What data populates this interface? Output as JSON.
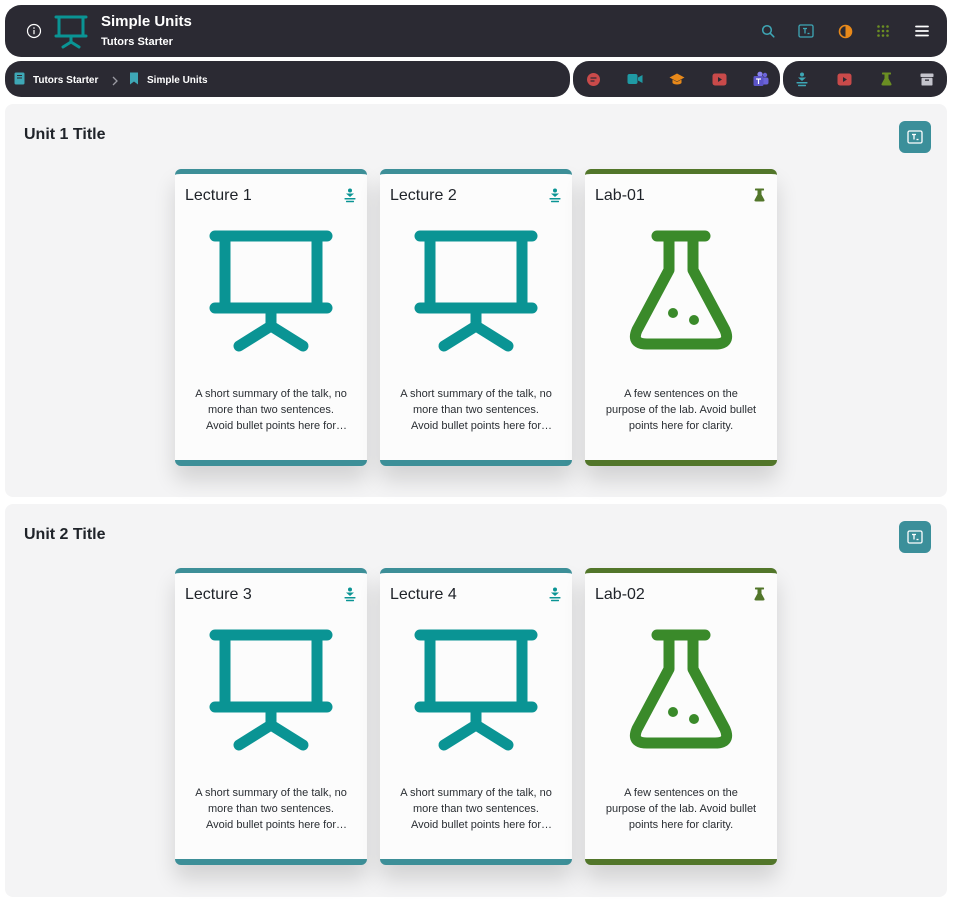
{
  "header": {
    "title": "Simple Units",
    "subtitle": "Tutors Starter",
    "icons": [
      "info-icon",
      "presentation-icon",
      "search-icon",
      "tutors-icon",
      "theme-contrast-icon",
      "apps-grid-icon",
      "hamburger-menu-icon"
    ]
  },
  "breadcrumb": {
    "items": [
      {
        "label": "Tutors Starter",
        "icon": "book-icon"
      },
      {
        "label": "Simple Units",
        "icon": "bookmark-icon"
      }
    ]
  },
  "companions": {
    "icons": [
      "chat-icon",
      "video-call-icon",
      "graduation-cap-icon",
      "youtube-icon",
      "teams-icon"
    ]
  },
  "walls": {
    "icons": [
      "lecture-wall-icon",
      "video-wall-icon",
      "lab-wall-icon",
      "archive-icon"
    ]
  },
  "colors": {
    "lecture": "#3d8f98",
    "lecture_art": "#0a9494",
    "lab": "#52762a",
    "lab_art": "#3a8a2a",
    "bar": "#2b2a33",
    "panel": "#f4f4f5",
    "accent_orange": "#e8891a",
    "accent_red": "#c94a4a",
    "accent_purple": "#6b63d9"
  },
  "units": [
    {
      "title": "Unit 1 Title",
      "cards": [
        {
          "title": "Lecture 1",
          "kind": "lecture",
          "summary": "A short summary of the talk, no more than two sentences. Avoid bullet points here for clarity."
        },
        {
          "title": "Lecture 2",
          "kind": "lecture",
          "summary": "A short summary of the talk, no more than two sentences. Avoid bullet points here for clarity."
        },
        {
          "title": "Lab-01",
          "kind": "lab",
          "summary": "A few sentences on the purpose of the lab. Avoid bullet points here for clarity."
        }
      ]
    },
    {
      "title": "Unit 2 Title",
      "cards": [
        {
          "title": "Lecture 3",
          "kind": "lecture",
          "summary": "A short summary of the talk, no more than two sentences. Avoid bullet points here for clarity."
        },
        {
          "title": "Lecture 4",
          "kind": "lecture",
          "summary": "A short summary of the talk, no more than two sentences. Avoid bullet points here for clarity."
        },
        {
          "title": "Lab-02",
          "kind": "lab",
          "summary": "A few sentences on the purpose of the lab. Avoid bullet points here for clarity."
        }
      ]
    }
  ]
}
